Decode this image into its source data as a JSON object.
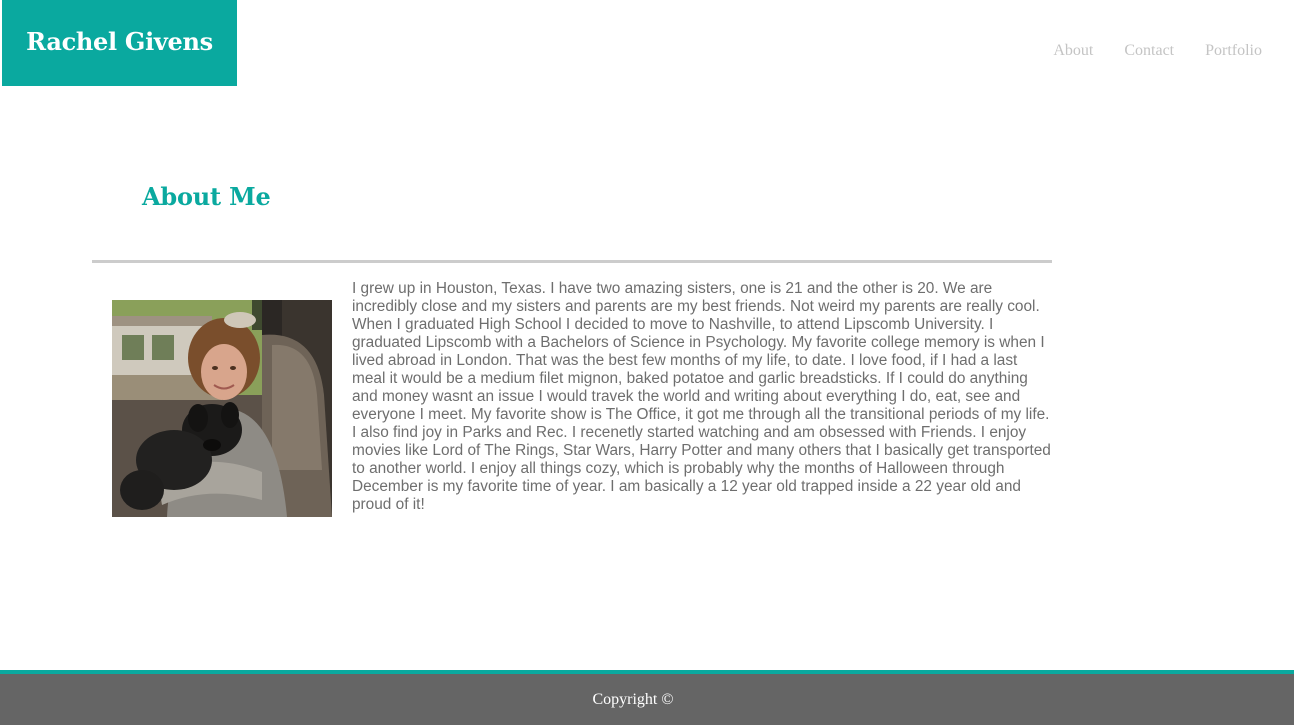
{
  "header": {
    "brand": "Rachel Givens",
    "nav": [
      "About",
      "Contact",
      "Portfolio"
    ]
  },
  "main": {
    "heading": "About Me",
    "bio": "I grew up in Houston, Texas. I have two amazing sisters, one is 21 and the other is 20. We are incredibly close and my sisters and parents are my best friends. Not weird my parents are really cool. When I graduated High School I decided to move to Nashville, to attend Lipscomb University. I graduated Lipscomb with a Bachelors of Science in Psychology. My favorite college memory is when I lived abroad in London. That was the best few months of my life, to date. I love food, if I had a last meal it would be a medium filet mignon, baked potatoe and garlic breadsticks. If I could do anything and money wasnt an issue I would travek the world and writing about everything I do, eat, see and everyone I meet. My favorite show is The Office, it got me through all the transitional periods of my life. I also find joy in Parks and Rec. I recenetly started watching and am obsessed with Friends. I enjoy movies like Lord of The Rings, Star Wars, Harry Potter and many others that I basically get transported to another world. I enjoy all things cozy, which is probably why the months of Halloween through December is my favorite time of year. I am basically a 12 year old trapped inside a 22 year old and proud of it!"
  },
  "footer": {
    "text": "Copyright ©"
  },
  "colors": {
    "accent": "#0aa99f",
    "footer_bg": "#656565",
    "nav_text": "#c4c4c4",
    "body_text": "#6e6e6e"
  }
}
